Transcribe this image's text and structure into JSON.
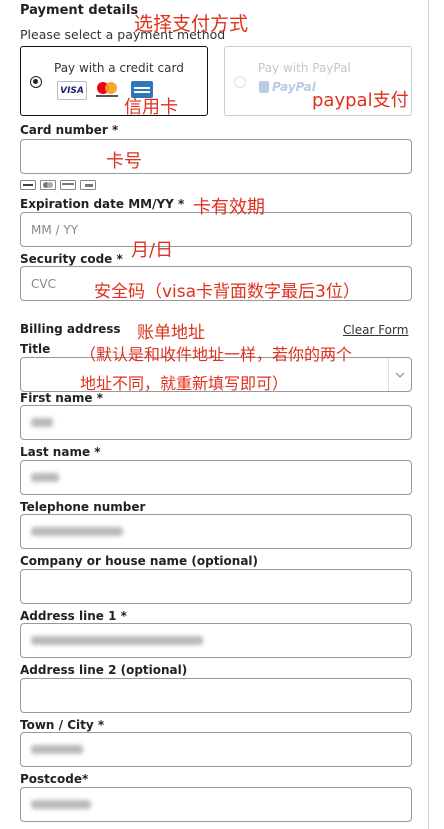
{
  "header": {
    "title": "Payment details",
    "subtitle": "Please select a payment method"
  },
  "payment_methods": [
    {
      "label": "Pay with a credit card",
      "selected": true
    },
    {
      "label": "Pay with PayPal",
      "selected": false,
      "logo_text": "PayPal"
    }
  ],
  "card_logos": [
    "VISA",
    "mastercard",
    "AMEX"
  ],
  "card_number": {
    "label": "Card number *",
    "value": ""
  },
  "small_card_icons": [
    "visa-icon",
    "mastercard-icon",
    "card-icon",
    "card-icon"
  ],
  "expiration": {
    "label": "Expiration date MM/YY *",
    "placeholder": "MM / YY"
  },
  "security_code": {
    "label": "Security code *",
    "placeholder": "CVC"
  },
  "billing": {
    "label": "Billing address",
    "clear_link": "Clear Form"
  },
  "title_field": {
    "label": "Title",
    "value": ""
  },
  "first_name": {
    "label": "First name *"
  },
  "last_name": {
    "label": "Last name *"
  },
  "telephone": {
    "label": "Telephone number"
  },
  "company": {
    "label": "Company or house name (optional)",
    "value": ""
  },
  "address1": {
    "label": "Address line 1 *"
  },
  "address2": {
    "label": "Address line 2 (optional)",
    "value": ""
  },
  "town": {
    "label": "Town / City *"
  },
  "postcode": {
    "label": "Postcode*"
  },
  "annotations": {
    "select_method": "选择支付方式",
    "credit_card": "信用卡",
    "paypal": "paypal支付",
    "card_number": "卡号",
    "expiry": "卡有效期",
    "month_day": "月/日",
    "security": "安全码（visa卡背面数字最后3位）",
    "billing": "账单地址",
    "billing_note_1": "（默认是和收件地址一样，若你的两个",
    "billing_note_2": "地址不同，就重新填写即可）"
  },
  "colors": {
    "annotation": "#e0301e",
    "border": "#999999",
    "paypal_blue": "#1f5fa8"
  }
}
